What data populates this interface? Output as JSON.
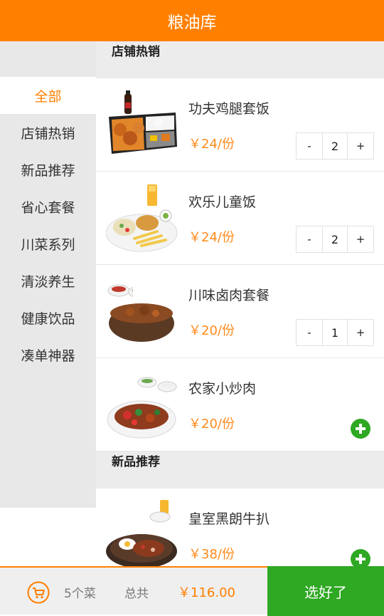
{
  "header": {
    "title": "粮油库"
  },
  "sidebar": {
    "items": [
      {
        "label": "全部"
      },
      {
        "label": "店铺热销"
      },
      {
        "label": "新品推荐"
      },
      {
        "label": "省心套餐"
      },
      {
        "label": "川菜系列"
      },
      {
        "label": "清淡养生"
      },
      {
        "label": "健康饮品"
      },
      {
        "label": "凑单神器"
      }
    ],
    "active_index": 0
  },
  "sections": [
    {
      "title": "店铺热销",
      "items": [
        {
          "name": "功夫鸡腿套饭",
          "price": "￥24/份",
          "qty": "2",
          "minus": "-",
          "plus": "+",
          "image_icon": "chicken-leg-set-meal-photo"
        },
        {
          "name": "欢乐儿童饭",
          "price": "￥24/份",
          "qty": "2",
          "minus": "-",
          "plus": "+",
          "image_icon": "kids-meal-photo"
        },
        {
          "name": "川味卤肉套餐",
          "price": "￥20/份",
          "qty": "1",
          "minus": "-",
          "plus": "+",
          "image_icon": "braised-pork-set-photo"
        },
        {
          "name": "农家小炒肉",
          "price": "￥20/份",
          "image_icon": "stir-fried-pork-photo"
        }
      ]
    },
    {
      "title": "新品推荐",
      "items": [
        {
          "name": "皇室黑朗牛扒",
          "price": "￥38/份",
          "image_icon": "steak-plate-photo"
        }
      ]
    }
  ],
  "footer": {
    "count": "5个菜",
    "total_label": "总共",
    "total": "￥116.00",
    "done_label": "选好了"
  },
  "colors": {
    "accent": "#ff7f00",
    "green": "#2fa823",
    "price": "#ff8a1c"
  }
}
